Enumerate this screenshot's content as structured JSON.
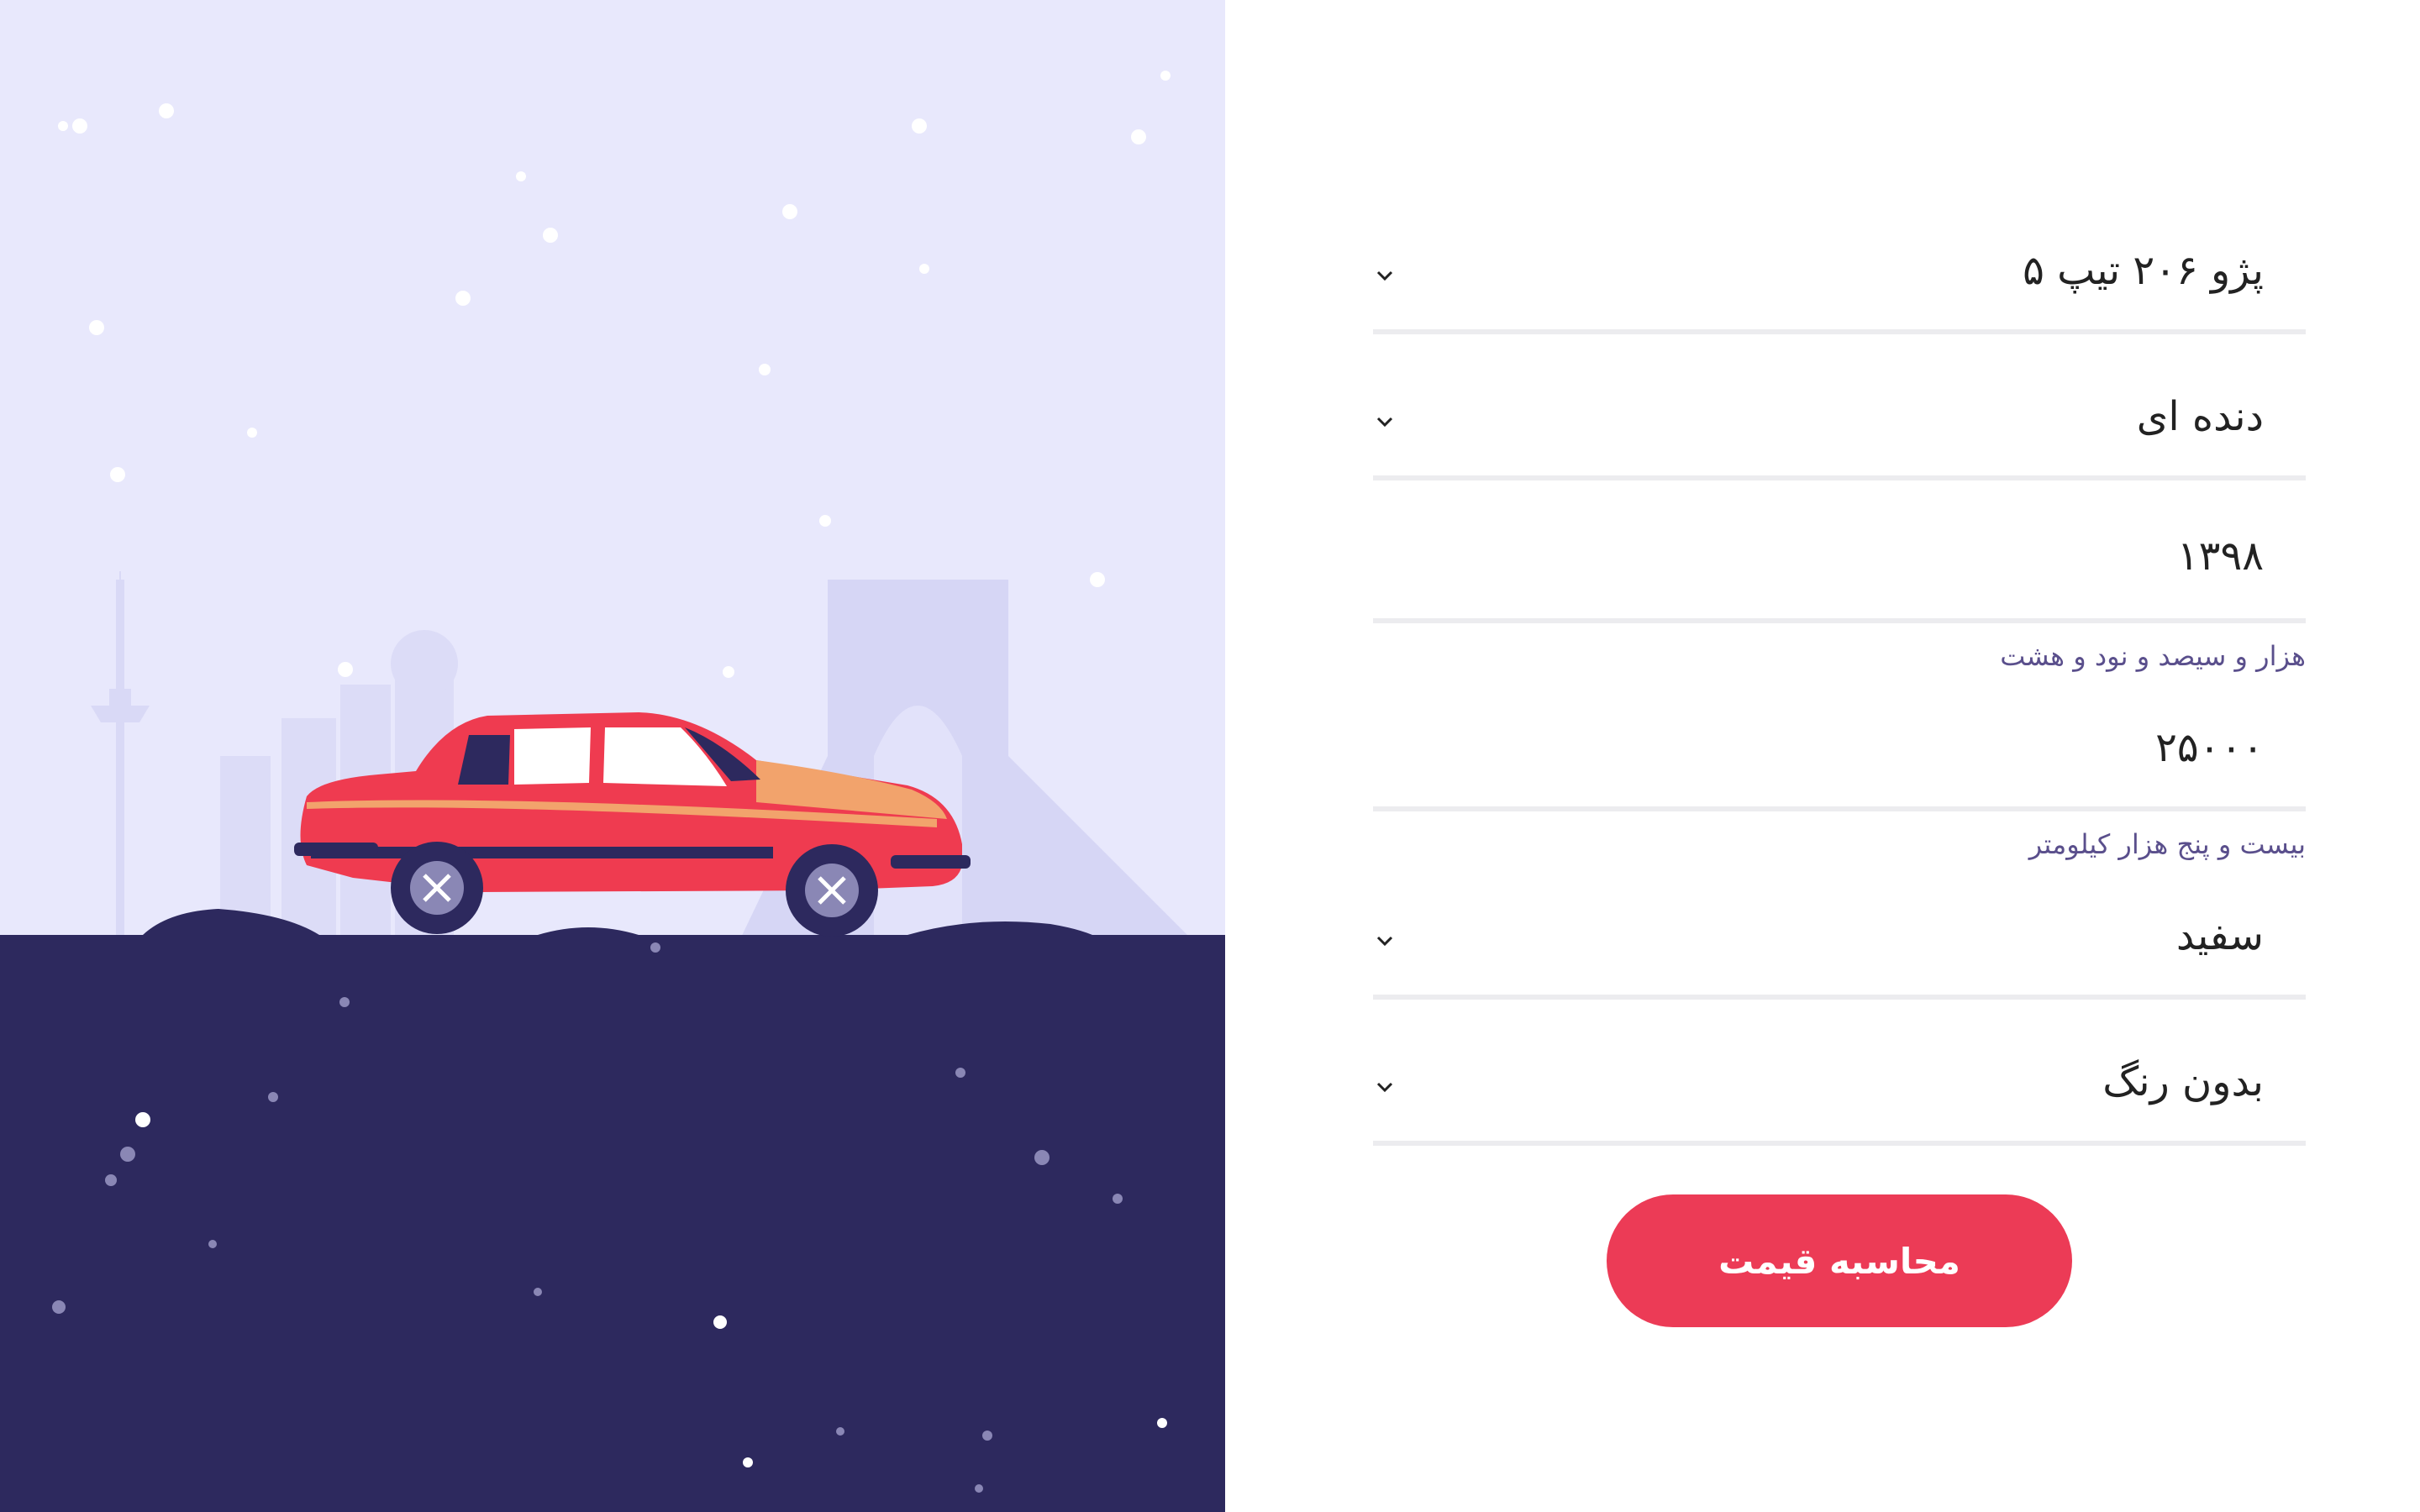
{
  "illustration": {
    "sky_color": "#e8e8fc",
    "ground_color": "#2d295e",
    "car_color": "#ef3b50"
  },
  "form": {
    "model": {
      "value": "پژو ۲۰۶ تیپ ۵",
      "icon": "chevron-down-icon"
    },
    "gearbox": {
      "value": "دنده ای",
      "icon": "chevron-down-icon"
    },
    "year": {
      "value": "۱۳۹۸",
      "hint": "هزار و سیصد و نود و هشت"
    },
    "mileage": {
      "value": "۲۵۰۰۰",
      "hint": "بیست و پنج هزار کیلومتر"
    },
    "color": {
      "value": "سفید",
      "icon": "chevron-down-icon"
    },
    "paint": {
      "value": "بدون رنگ",
      "icon": "chevron-down-icon"
    },
    "submit_label": "محاسبه قیمت"
  },
  "colors": {
    "accent": "#ec3b56",
    "hint": "#5a4f8c",
    "divider": "#ececef"
  }
}
